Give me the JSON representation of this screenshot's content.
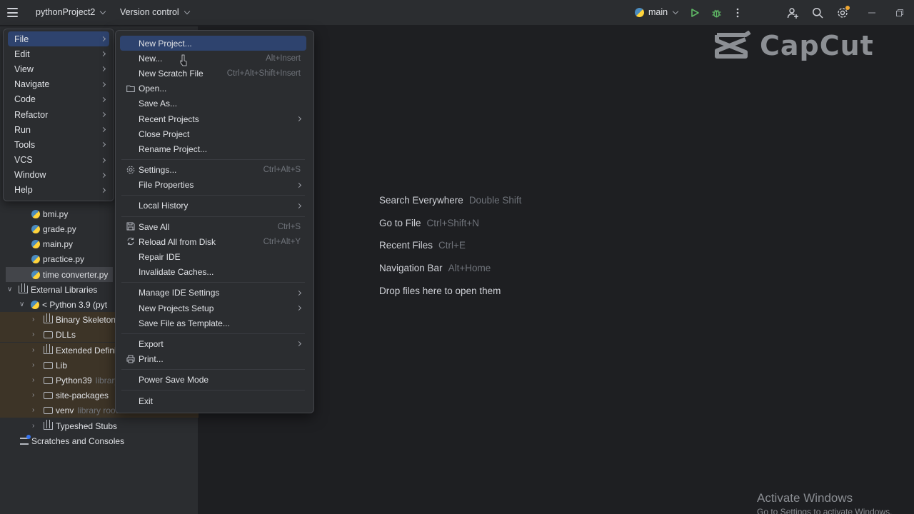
{
  "titlebar": {
    "project_name": "pythonProject2",
    "vcs_label": "Version control",
    "branch": "main",
    "icons": [
      "hamburger-menu-icon",
      "python-icon",
      "run-icon",
      "debug-icon",
      "more-icon",
      "add-user-icon",
      "search-icon",
      "settings-icon",
      "minimize-icon",
      "restore-icon"
    ],
    "colors": {
      "run": "#5fb865",
      "debug": "#5fb865",
      "notification": "#f0a732"
    }
  },
  "main_menu": {
    "items": [
      {
        "label": "File",
        "active": true
      },
      {
        "label": "Edit"
      },
      {
        "label": "View"
      },
      {
        "label": "Navigate"
      },
      {
        "label": "Code"
      },
      {
        "label": "Refactor"
      },
      {
        "label": "Run"
      },
      {
        "label": "Tools"
      },
      {
        "label": "VCS"
      },
      {
        "label": "Window"
      },
      {
        "label": "Help"
      }
    ]
  },
  "file_menu": {
    "items": [
      {
        "label": "New Project...",
        "active": true
      },
      {
        "label": "New...",
        "shortcut": "Alt+Insert"
      },
      {
        "label": "New Scratch File",
        "shortcut": "Ctrl+Alt+Shift+Insert"
      },
      {
        "label": "Open...",
        "icon": "folder-icon"
      },
      {
        "label": "Save As..."
      },
      {
        "label": "Recent Projects",
        "submenu": true
      },
      {
        "label": "Close Project"
      },
      {
        "label": "Rename Project..."
      },
      {
        "separator": true
      },
      {
        "label": "Settings...",
        "shortcut": "Ctrl+Alt+S",
        "icon": "gear-icon"
      },
      {
        "label": "File Properties",
        "submenu": true
      },
      {
        "separator": true
      },
      {
        "label": "Local History",
        "submenu": true
      },
      {
        "separator": true
      },
      {
        "label": "Save All",
        "shortcut": "Ctrl+S",
        "icon": "save-icon"
      },
      {
        "label": "Reload All from Disk",
        "shortcut": "Ctrl+Alt+Y",
        "icon": "reload-icon"
      },
      {
        "label": "Repair IDE"
      },
      {
        "label": "Invalidate Caches..."
      },
      {
        "separator": true
      },
      {
        "label": "Manage IDE Settings",
        "submenu": true
      },
      {
        "label": "New Projects Setup",
        "submenu": true
      },
      {
        "label": "Save File as Template..."
      },
      {
        "separator": true
      },
      {
        "label": "Export",
        "submenu": true
      },
      {
        "label": "Print...",
        "icon": "print-icon"
      },
      {
        "separator": true
      },
      {
        "label": "Power Save Mode"
      },
      {
        "separator": true
      },
      {
        "label": "Exit"
      }
    ]
  },
  "project_tree": {
    "items": [
      {
        "label": "bmi.py",
        "type": "python"
      },
      {
        "label": "grade.py",
        "type": "python"
      },
      {
        "label": "main.py",
        "type": "python"
      },
      {
        "label": "practice.py",
        "type": "python"
      },
      {
        "label": "time converter.py",
        "type": "python",
        "selected": true
      },
      {
        "label": "External Libraries",
        "type": "library",
        "expanded": true
      },
      {
        "label": "< Python 3.9 (pyt",
        "type": "python-sdk",
        "expanded": true
      },
      {
        "label": "Binary Skeletons",
        "type": "library",
        "collapsed": true,
        "lib": true
      },
      {
        "label": "DLLs",
        "type": "folder",
        "collapsed": true,
        "lib": true
      },
      {
        "label": "Extended Definitions",
        "type": "library",
        "collapsed": true,
        "lib": true
      },
      {
        "label": "Lib",
        "type": "folder",
        "collapsed": true,
        "lib": true
      },
      {
        "label": "Python39",
        "hint": "library root",
        "type": "folder",
        "collapsed": true,
        "lib": true
      },
      {
        "label": "site-packages",
        "type": "folder",
        "collapsed": true,
        "lib": true
      },
      {
        "label": "venv",
        "hint": "library root",
        "type": "folder",
        "collapsed": true,
        "lib": true
      },
      {
        "label": "Typeshed Stubs",
        "type": "library",
        "collapsed": true
      },
      {
        "label": "Scratches and Consoles",
        "type": "scratch"
      }
    ]
  },
  "welcome": {
    "lines": [
      {
        "label": "Search Everywhere",
        "shortcut": "Double Shift"
      },
      {
        "label": "Go to File",
        "shortcut": "Ctrl+Shift+N"
      },
      {
        "label": "Recent Files",
        "shortcut": "Ctrl+E"
      },
      {
        "label": "Navigation Bar",
        "shortcut": "Alt+Home"
      },
      {
        "label": "Drop files here to open them",
        "shortcut": ""
      }
    ]
  },
  "watermark": {
    "brand": "CapCut",
    "activate_title": "Activate Windows",
    "activate_sub": "Go to Settings to activate Windows."
  }
}
